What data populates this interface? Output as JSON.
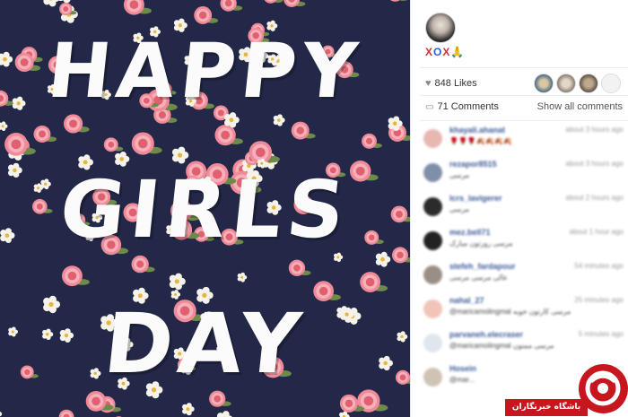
{
  "image": {
    "headline_lines": [
      "HAPPY",
      "GIRLS",
      "DAY"
    ]
  },
  "post": {
    "caption": {
      "x1": "X",
      "o": "O",
      "x2": "X",
      "hands": "🙏"
    },
    "likes": "848 Likes",
    "comments_count": "71 Comments",
    "show_all": "Show all comments"
  },
  "comments": [
    {
      "user": "khayali.ahanat",
      "time": "about 3 hours ago",
      "text": "🌹🌹🌹🍂🍂🍂🍂"
    },
    {
      "user": "rezapor8515",
      "time": "about 3 hours ago",
      "text": "مرسی"
    },
    {
      "user": "lcrs_lavigerer",
      "time": "about 2 hours ago",
      "text": "مرسی"
    },
    {
      "user": "mez.bell71",
      "time": "about 1 hour ago",
      "text": "مرسی روزتون مبارک"
    },
    {
      "user": "stefeh_fardapour",
      "time": "54 minutes ago",
      "text": "عالی مرسی مرسی"
    },
    {
      "user": "nahal_27",
      "time": "25 minutes ago",
      "text": "@maricamolingmal مرسی کارتون خوبه"
    },
    {
      "user": "parvaneh.elecraser",
      "time": "5 minutes ago",
      "text": "@maricamolingmal مرسی ممنون"
    },
    {
      "user": "Hosein",
      "time": "",
      "text": "@mar..."
    }
  ],
  "watermark": {
    "text": "باشگاه خبرنگاران"
  },
  "colors": {
    "background_fabric": "#232848",
    "flower_pink": "#f08a98",
    "flower_white": "#f5f2ea",
    "watermark_red": "#c8161f",
    "link_blue": "#3b5998"
  }
}
